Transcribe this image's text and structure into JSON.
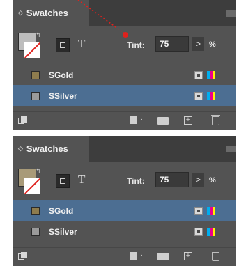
{
  "panels": [
    {
      "title": "Swatches",
      "fill_color": "#bdbdbd",
      "tint_label": "Tint:",
      "tint_value": "75",
      "tint_arrow": ">",
      "tint_unit": "%",
      "format_text_glyph": "T",
      "swatches": [
        {
          "name": "SGold",
          "color": "#8e7c4e",
          "selected": false
        },
        {
          "name": "SSilver",
          "color": "#9a9a9a",
          "selected": true
        }
      ]
    },
    {
      "title": "Swatches",
      "fill_color": "#a89a78",
      "tint_label": "Tint:",
      "tint_value": "75",
      "tint_arrow": ">",
      "tint_unit": "%",
      "format_text_glyph": "T",
      "swatches": [
        {
          "name": "SGold",
          "color": "#8e7c4e",
          "selected": true
        },
        {
          "name": "SSilver",
          "color": "#9a9a9a",
          "selected": false
        }
      ]
    }
  ],
  "accent_color": "#4c6e92",
  "callout_color": "#e0211d",
  "icons": [
    "panel-collapse-icon",
    "panel-menu-icon",
    "swap-fill-stroke-icon",
    "format-container-icon",
    "format-text-icon",
    "process-color-icon",
    "cmyk-mode-icon",
    "show-swatch-kinds-icon",
    "swatch-views-icon",
    "new-color-group-icon",
    "new-swatch-icon",
    "delete-swatch-icon"
  ]
}
